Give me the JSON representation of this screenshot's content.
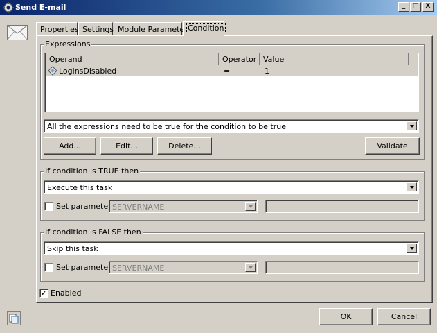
{
  "window": {
    "title": "Send E-mail"
  },
  "titlebar_buttons": {
    "minimize": "_",
    "maximize": "□",
    "close": "X"
  },
  "tabs": [
    "Properties",
    "Settings",
    "Module Parameters",
    "Condition"
  ],
  "active_tab": "Condition",
  "expressions": {
    "group_label": "Expressions",
    "columns": [
      "Operand",
      "Operator",
      "Value"
    ],
    "rows": [
      {
        "operand": "LoginsDisabled",
        "operator": "=",
        "value": "1"
      }
    ],
    "mode": "All the expressions need to be true for the condition to be true",
    "buttons": {
      "add": "Add...",
      "edit": "Edit...",
      "delete": "Delete...",
      "validate": "Validate"
    }
  },
  "true_group": {
    "label": "If condition is TRUE then",
    "action": "Execute this task",
    "set_parameter_label": "Set parameter:",
    "set_parameter_checked": false,
    "parameter": "SERVERNAME",
    "parameter_value": ""
  },
  "false_group": {
    "label": "If condition is FALSE then",
    "action": "Skip this task",
    "set_parameter_label": "Set parameter:",
    "set_parameter_checked": false,
    "parameter": "SERVERNAME",
    "parameter_value": ""
  },
  "enabled": {
    "label": "Enabled",
    "checked": true,
    "mark": "✓"
  },
  "footer": {
    "ok": "OK",
    "cancel": "Cancel"
  },
  "colors": {
    "titlebar": "#0a246a",
    "face": "#d4d0c8",
    "selection_row": "#d4d0c8"
  }
}
